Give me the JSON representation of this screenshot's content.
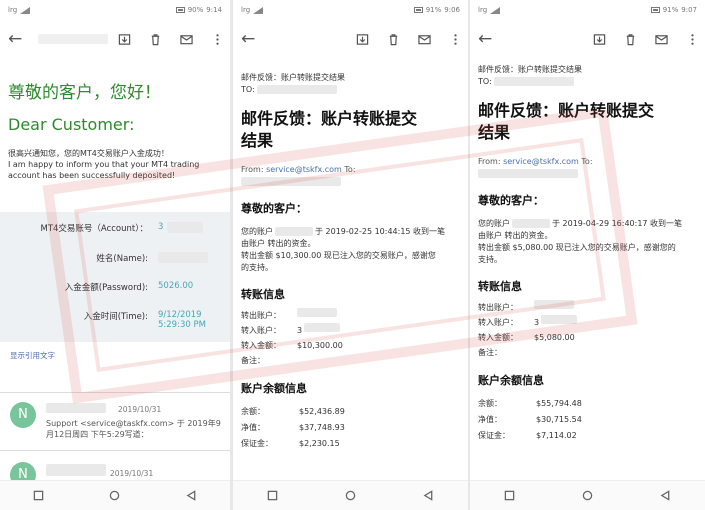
{
  "phone1": {
    "status": {
      "carrier": "lrg",
      "battery": "90%",
      "time": "9:14"
    },
    "greeting_zh": "尊敬的客户，您好！",
    "greeting_en": "Dear Customer:",
    "note_zh": "很高兴通知您，您的MT4交易账户入金成功！",
    "note_en_1": "I am happy to inform you that your MT4 trading",
    "note_en_2": "account has been successfully deposited!",
    "rows": [
      {
        "label": "MT4交易账号（Account）：",
        "value": "3"
      },
      {
        "label": "姓名(Name):",
        "value": ""
      },
      {
        "label": "入金金额(Password):",
        "value": "5026.00"
      },
      {
        "label": "入金时间(Time):",
        "value": "9/12/2019"
      },
      {
        "label": "",
        "value": "5:29:30 PM"
      }
    ],
    "show_quoted": "显示引用文字",
    "msg1": {
      "avatar": "N",
      "date": "2019/10/31",
      "text1": "Support <service@taskfx.com> 于 2019年9",
      "text2": "月12日周四 下午5:29写道："
    },
    "msg2": {
      "avatar": "N",
      "date": "2019/10/31"
    }
  },
  "phone2": {
    "status": {
      "carrier": "lrg",
      "battery": "91%",
      "time": "9:06"
    },
    "header_subject": "邮件反馈：账户转账提交结果",
    "header_to": "TO:",
    "subject_1": "邮件反馈：账户转账提交",
    "subject_2": "结果",
    "from_label": "From:",
    "from_email": "service@tskfx.com",
    "to_label": "To:",
    "salutation": "尊敬的客户：",
    "para_1": "您的账户",
    "para_2": "于 2019-02-25 10:44:15 收到一笔",
    "para_3": "由账户 转出的资金。",
    "para_4": "转出金额 $10,300.00 现已注入您的交易账户，感谢您",
    "para_5": "的支持。",
    "transfer_title": "转账信息",
    "transfer": [
      {
        "k": "转出账户：",
        "v": ""
      },
      {
        "k": "转入账户：",
        "v": "3"
      },
      {
        "k": "转入金额：",
        "v": "$10,300.00"
      },
      {
        "k": "备注：",
        "v": ""
      }
    ],
    "balance_title": "账户余额信息",
    "balance": [
      {
        "k": "余额：",
        "v": "$52,436.89"
      },
      {
        "k": "净值：",
        "v": "$37,748.93"
      },
      {
        "k": "保证金：",
        "v": "$2,230.15"
      }
    ]
  },
  "phone3": {
    "status": {
      "carrier": "lrg",
      "battery": "91%",
      "time": "9:07"
    },
    "header_subject": "邮件反馈：账户转账提交结果",
    "header_to": "TO:",
    "subject_1": "邮件反馈：账户转账提交",
    "subject_2": "结果",
    "from_label": "From:",
    "from_email": "service@tskfx.com",
    "to_label": "To:",
    "salutation": "尊敬的客户：",
    "para_1": "您的账户",
    "para_2": "于 2019-04-29 16:40:17 收到一笔",
    "para_3": "由账户 转出的资金。",
    "para_4": "转出金额 $5,080.00 现已注入您的交易账户，感谢您的",
    "para_5": "支持。",
    "transfer_title": "转账信息",
    "transfer": [
      {
        "k": "转出账户：",
        "v": ""
      },
      {
        "k": "转入账户：",
        "v": "3"
      },
      {
        "k": "转入金额：",
        "v": "$5,080.00"
      },
      {
        "k": "备注：",
        "v": ""
      }
    ],
    "balance_title": "账户余额信息",
    "balance": [
      {
        "k": "余额：",
        "v": "$55,794.48"
      },
      {
        "k": "净值：",
        "v": "$30,715.54"
      },
      {
        "k": "保证金：",
        "v": "$7,114.02"
      }
    ]
  },
  "colors": {
    "green_text": "#2e8a2e",
    "link_blue": "#4b6fa8",
    "stamp_red": "#d9534f",
    "avatar_green": "#78c59b"
  }
}
